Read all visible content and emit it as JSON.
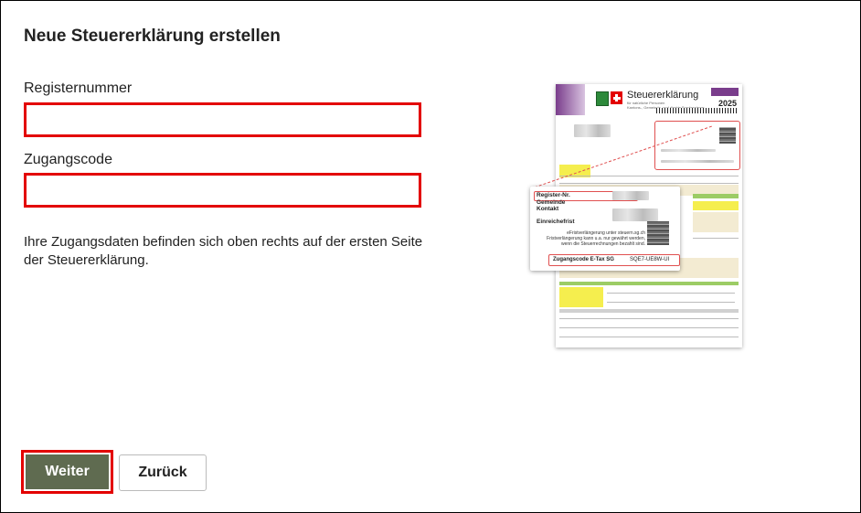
{
  "dialog": {
    "title": "Neue Steuererklärung erstellen",
    "register_label": "Registernummer",
    "register_value": "",
    "code_label": "Zugangscode",
    "code_value": "",
    "hint": "Ihre Zugangsdaten befinden sich oben rechts auf der ersten Seite der Steuererklärung.",
    "next_button": "Weiter",
    "back_button": "Zurück"
  },
  "illustration": {
    "doc_title": "Steuererklärung",
    "doc_year": "2025",
    "doc_subtitle": "für natürliche Personen\nKantons-, Gemeinde- und direkte Bundessteuer",
    "popup": {
      "register": "Register-Nr.",
      "gemeinde": "Gemeinde",
      "kontakt": "Kontakt",
      "frist": "Einreichefrist",
      "note": "eFristverlängerung unter steuern.sg.ch\nFristverlängerung kann u.a. nur gewährt werden,\nwenn die Steuerrechnungen bezahlt sind.",
      "code_label": "Zugangscode E-Tax SG",
      "code_value": "SQE7-UE8W-UI"
    }
  },
  "colors": {
    "accent_red": "#e30000",
    "primary_button": "#5f6b50",
    "doc_purple": "#7a3d8c"
  }
}
